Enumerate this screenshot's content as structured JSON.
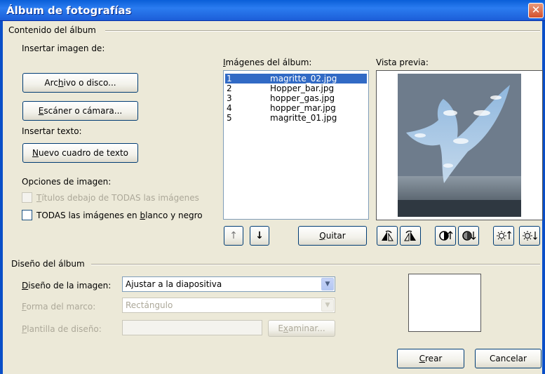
{
  "window": {
    "title": "Álbum de fotografías",
    "close_glyph": "✕"
  },
  "content_group": {
    "label": "Contenido del álbum",
    "insert_image_label": "Insertar imagen de:",
    "file_button": {
      "pre": "Arc",
      "ul": "h",
      "post": "ivo o disco..."
    },
    "scanner_button": {
      "pre": "",
      "ul": "E",
      "post": "scáner o cámara..."
    },
    "insert_text_label": "Insertar texto:",
    "textbox_button": {
      "pre": "",
      "ul": "N",
      "post": "uevo cuadro de texto"
    },
    "image_options_label": "Opciones de imagen:",
    "captions_option": {
      "pre": "",
      "ul": "T",
      "post": "ítulos debajo de TODAS las imágenes"
    },
    "bw_option": {
      "pre": "TODAS las imágenes en ",
      "ul": "b",
      "post": "lanco y negro"
    }
  },
  "images_list": {
    "label": {
      "pre": "",
      "ul": "I",
      "post": "mágenes del álbum:"
    },
    "items": [
      {
        "num": "1",
        "name": "magritte_02.jpg",
        "selected": true
      },
      {
        "num": "2",
        "name": "Hopper_bar.jpg",
        "selected": false
      },
      {
        "num": "3",
        "name": "hopper_gas.jpg",
        "selected": false
      },
      {
        "num": "4",
        "name": "hopper_mar.jpg",
        "selected": false
      },
      {
        "num": "5",
        "name": "magritte_01.jpg",
        "selected": false
      }
    ],
    "move_up_glyph": "↑",
    "move_down_glyph": "↓",
    "remove_button": {
      "pre": "",
      "ul": "Q",
      "post": "uitar"
    }
  },
  "preview": {
    "label": "Vista previa:",
    "tools": [
      "rotate-left-icon",
      "rotate-right-icon",
      "contrast-up-icon",
      "contrast-down-icon",
      "brightness-up-icon",
      "brightness-down-icon"
    ]
  },
  "layout_group": {
    "label": "Diseño del álbum",
    "image_layout_label": {
      "pre": "",
      "ul": "D",
      "post": "iseño de la imagen:"
    },
    "image_layout_value": "Ajustar a la diapositiva",
    "frame_shape_label": {
      "pre": "",
      "ul": "F",
      "post": "orma del marco:"
    },
    "frame_shape_value": "Rectángulo",
    "design_template_label": {
      "pre": "",
      "ul": "P",
      "post": "lantilla de diseño:"
    },
    "design_template_value": "",
    "browse_button": {
      "pre": "E",
      "ul": "x",
      "post": "aminar..."
    }
  },
  "footer": {
    "create_button": {
      "pre": "",
      "ul": "C",
      "post": "rear"
    },
    "cancel_label": "Cancelar"
  },
  "colors": {
    "title_bar": "#0a5fd8",
    "dialog_bg": "#ece9d8",
    "selection": "#316ac5",
    "close_button": "#d4502c"
  }
}
